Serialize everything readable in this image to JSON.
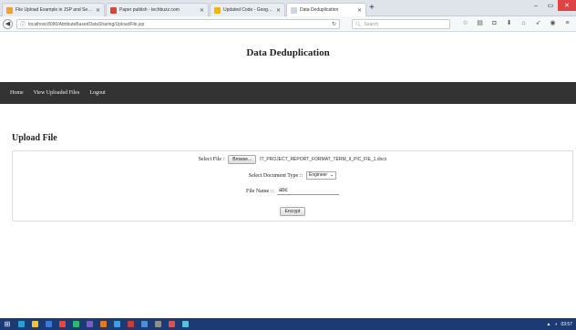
{
  "browser": {
    "tabs": [
      {
        "label": "File Upload Example in JSP and Servlet",
        "fav_color": "#f0a030",
        "active": false
      },
      {
        "label": "Paper publish - techbuzz.com",
        "fav_color": "#d44638",
        "active": false
      },
      {
        "label": "Updated Code - Google Drive",
        "fav_color": "#f4b400",
        "active": false
      },
      {
        "label": "Data Deduplication",
        "fav_color": "#cfd3da",
        "active": true
      }
    ],
    "new_tab": "+",
    "window_controls": {
      "minimize": "–",
      "maximize": "▭",
      "close": "✕"
    },
    "url": "localhost:8080/AttributeBasedDataSharing/UploadFile.jsp",
    "search_placeholder": "Search"
  },
  "page": {
    "title": "Data Deduplication",
    "nav": [
      "Home",
      "View Uploaded Files",
      "Logout"
    ],
    "section_title": "Upload File",
    "form": {
      "select_file_label": "Select File :",
      "browse_label": "Browse...",
      "file_name_selected": "IT_PROJECT_REPORT_FORMAT_TERM_II_PIC_FIE_1.docx",
      "doc_type_label": "Select Document Type ::",
      "doc_type_selected": "Engineer",
      "file_name_label": "File Name ::",
      "file_name_value": "abc",
      "submit_label": "Encrypt"
    }
  },
  "taskbar": {
    "apps": [
      "#2a9fd6",
      "#f3c13a",
      "#3a7bd5",
      "#e8473f",
      "#2eb872",
      "#7a5cc4",
      "#e07b22",
      "#3ba1e3",
      "#c93c3c",
      "#4a90d9",
      "#8e8e8e",
      "#d9534f",
      "#5bc0de"
    ],
    "time": "03:57"
  }
}
